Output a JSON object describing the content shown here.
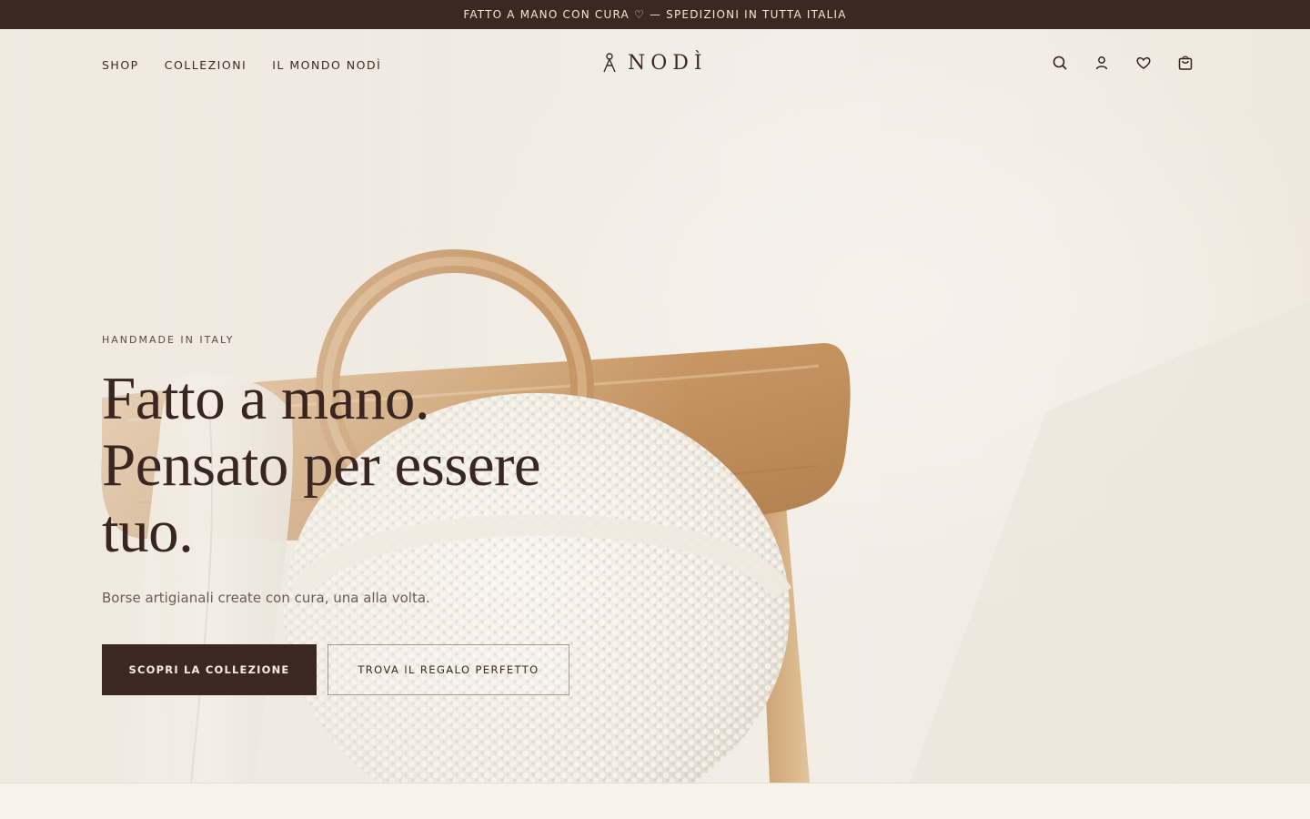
{
  "announcement": {
    "text": "FATTO A MANO CON CURA ♡ — SPEDIZIONI IN TUTTA ITALIA"
  },
  "nav": {
    "items": [
      {
        "label": "SHOP"
      },
      {
        "label": "COLLEZIONI"
      },
      {
        "label": "IL MONDO NODÌ"
      }
    ]
  },
  "brand": {
    "name": "NODÌ",
    "logo_icon": "knot-figure-icon"
  },
  "header_icons": [
    "search-icon",
    "account-icon",
    "heart-icon",
    "bag-icon"
  ],
  "hero": {
    "eyebrow": "HANDMADE IN ITALY",
    "headline_line1": "Fatto a mano.",
    "headline_line2": "Pensato per essere",
    "headline_line3": "tuo.",
    "subtitle": "Borse artigianali create con cura, una alla volta.",
    "cta_primary": "SCOPRI LA COLLEZIONE",
    "cta_secondary": "TROVA IL REGALO PERFETTO"
  },
  "colors": {
    "brand_dark": "#3b2820",
    "background": "#f7f3ec",
    "text": "#3b2a22",
    "wood": "#c89a6a",
    "crochet": "#f3efe7"
  }
}
